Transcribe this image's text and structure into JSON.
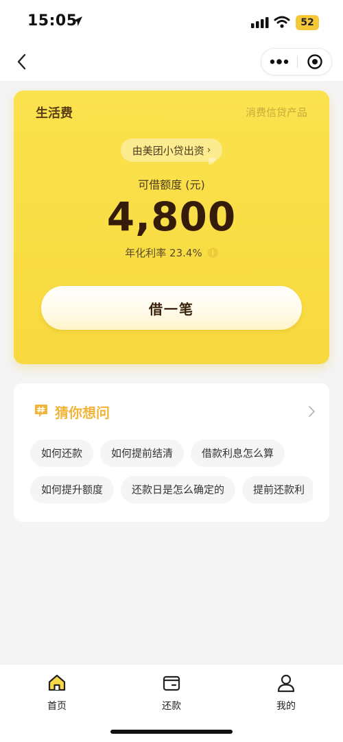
{
  "status_bar": {
    "time": "15:05",
    "battery": "52",
    "icons": [
      "location-arrow-icon",
      "signal-icon",
      "wifi-icon",
      "battery-icon"
    ]
  },
  "nav": {
    "back_icon": "chevron-left-icon",
    "more_icon": "more-dots-icon",
    "close_icon": "target-close-icon"
  },
  "loan_card": {
    "product_name": "生活费",
    "product_type": "消费信贷产品",
    "lender": "由美团小贷出资",
    "lender_chevron": "›",
    "limit_label": "可借额度 (元)",
    "limit_amount": "4,800",
    "rate_label": "年化利率 23.4%",
    "rate_info_icon": "info-icon",
    "borrow_button": "借一笔",
    "colors": {
      "card": "#f9dd45",
      "amount": "#351c0a"
    }
  },
  "faq": {
    "title": "猜你想问",
    "icon": "hashtag-chat-icon",
    "chips_row1": [
      "如何还款",
      "如何提前结清",
      "借款利息怎么算"
    ],
    "chips_row2": [
      "如何提升额度",
      "还款日是怎么确定的",
      "提前还款利"
    ],
    "colors": {
      "title": "#f1b43a"
    }
  },
  "tabs": [
    {
      "label": "首页",
      "icon": "home-icon",
      "active": true
    },
    {
      "label": "还款",
      "icon": "wallet-icon",
      "active": false
    },
    {
      "label": "我的",
      "icon": "user-icon",
      "active": false
    }
  ]
}
